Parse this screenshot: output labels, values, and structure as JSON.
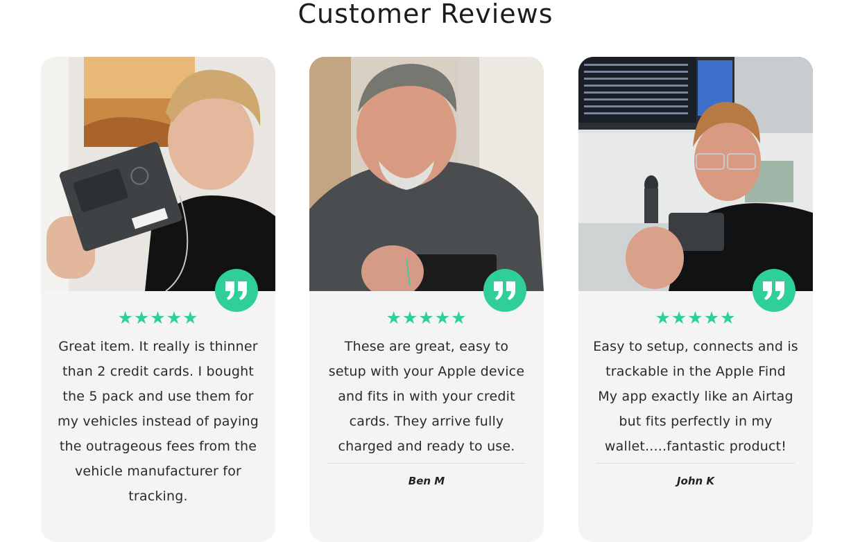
{
  "section": {
    "title": "Customer Reviews"
  },
  "colors": {
    "accent": "#2fcf97",
    "card_bg": "#f4f4f4"
  },
  "reviews": [
    {
      "stars": "★★★★★",
      "rating": 5,
      "lines": [
        "Great item. It really is thinner",
        "than 2 credit cards. I bought",
        "the 5 pack and use them for",
        "my vehicles instead of paying",
        "the outrageous fees from the",
        "vehicle manufacturer for",
        "tracking."
      ],
      "author": "",
      "quote_icon": "quote-icon"
    },
    {
      "stars": "★★★★★",
      "rating": 5,
      "lines": [
        "These are great, easy to",
        "setup with your Apple device",
        "and fits in with your credit",
        "cards. They arrive fully",
        "charged and ready to use."
      ],
      "author": "Ben M",
      "quote_icon": "quote-icon"
    },
    {
      "stars": "★★★★★",
      "rating": 5,
      "lines": [
        "Easy to setup, connects and is",
        "trackable in the Apple Find",
        "My app exactly like an Airtag",
        "but fits perfectly in my",
        "wallet.....fantastic product!"
      ],
      "author": "John K",
      "quote_icon": "quote-icon"
    }
  ]
}
